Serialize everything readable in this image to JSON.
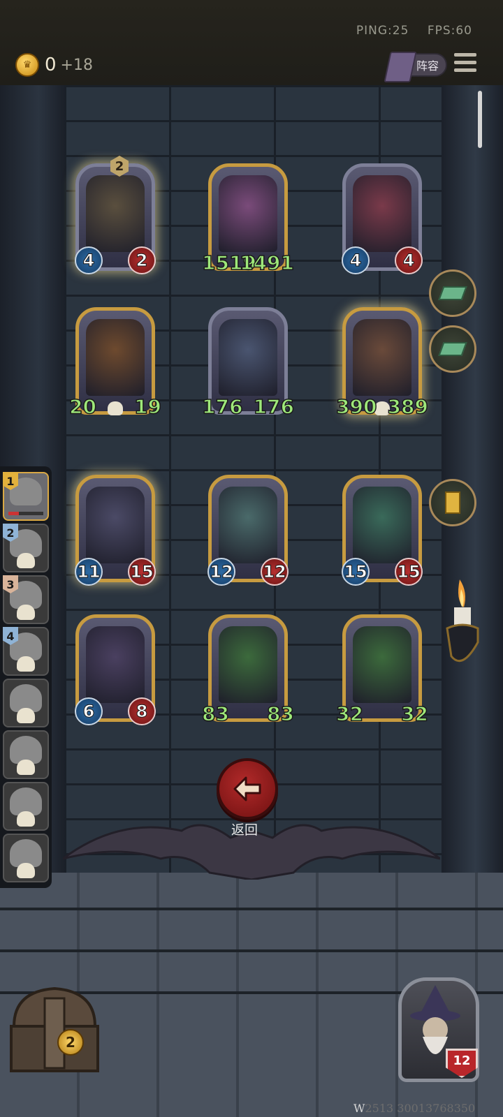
{
  "header": {
    "ping": "PING:25",
    "fps": "FPS:60",
    "coins": "0",
    "coins_income": "+18",
    "lineup_label": "阵容"
  },
  "board": {
    "cards": [
      {
        "id": "c1",
        "atk": "4",
        "hp": "2",
        "tier": "2",
        "frame": "silver",
        "glow": true
      },
      {
        "id": "c2",
        "atk": "1519",
        "hp": "1491",
        "frame": "gold",
        "wide": true
      },
      {
        "id": "c3",
        "atk": "4",
        "hp": "4",
        "frame": "silver"
      },
      {
        "id": "c4",
        "atk": "20",
        "hp": "19",
        "frame": "gold",
        "wide": true,
        "skull": true
      },
      {
        "id": "c5",
        "atk": "176",
        "hp": "176",
        "frame": "silver",
        "wide": true
      },
      {
        "id": "c6",
        "atk": "390",
        "hp": "389",
        "frame": "gold",
        "wide": true,
        "skull": true,
        "glow": true
      },
      {
        "id": "c7",
        "atk": "11",
        "hp": "15",
        "frame": "gold",
        "glow": true
      },
      {
        "id": "c8",
        "atk": "12",
        "hp": "12",
        "frame": "gold"
      },
      {
        "id": "c9",
        "atk": "15",
        "hp": "15",
        "frame": "gold"
      },
      {
        "id": "c10",
        "atk": "6",
        "hp": "8",
        "frame": "gold"
      },
      {
        "id": "c11",
        "atk": "83",
        "hp": "83",
        "frame": "gold",
        "wide": true
      },
      {
        "id": "c12",
        "atk": "32",
        "hp": "32",
        "frame": "gold",
        "wide": true
      }
    ]
  },
  "players": [
    {
      "rank": "1",
      "active": true
    },
    {
      "rank": "2"
    },
    {
      "rank": "3"
    },
    {
      "rank": "4"
    },
    {
      "rank": ""
    },
    {
      "rank": ""
    },
    {
      "rank": ""
    },
    {
      "rank": ""
    }
  ],
  "back_label": "返回",
  "chest_gold": "2",
  "hero_hp": "12",
  "watermark": {
    "lead": "W",
    "rest": "2513 30013768350"
  },
  "colors": {
    "gold_frame": "#c79b40",
    "silver_frame": "#7d7f97",
    "buff_text": "#9ee87a",
    "back_button": "#b22a2a"
  }
}
